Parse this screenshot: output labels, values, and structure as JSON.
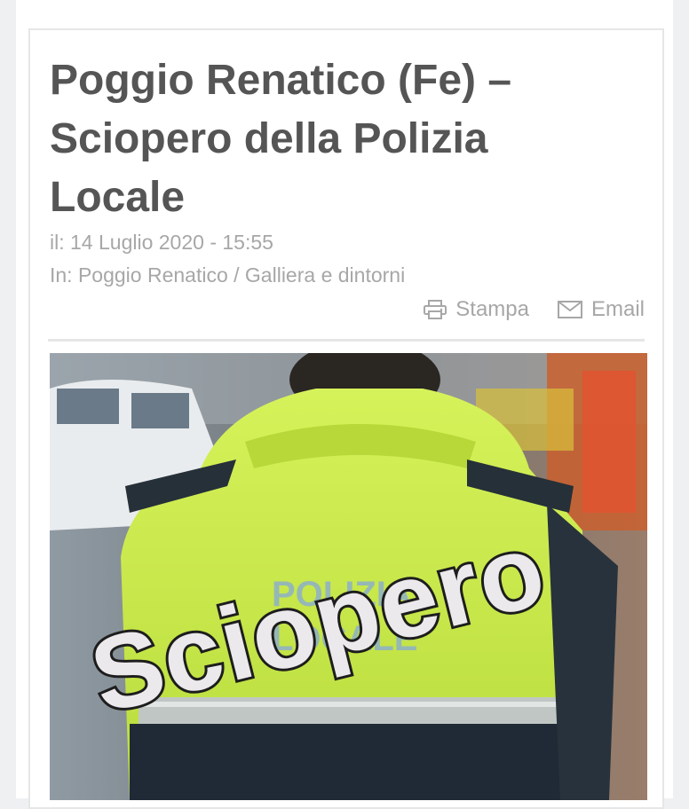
{
  "article": {
    "title": "Poggio Renatico (Fe) – Sciopero della Polizia Locale",
    "date_prefix": "il:",
    "date": "14 Luglio 2020 - 15:55",
    "category_prefix": "In:",
    "category": "Poggio Renatico / Galliera e dintorni"
  },
  "actions": {
    "print_label": "Stampa",
    "email_label": "Email",
    "print_icon": "printer-icon",
    "email_icon": "envelope-icon"
  },
  "image": {
    "overlay_text": "Sciopero",
    "jacket_text_line1": "POLIZIA",
    "jacket_text_line2": "LOCALE"
  },
  "colors": {
    "title": "#555555",
    "meta": "#a7a7a7",
    "divider": "#e6e6e6",
    "jacket": "#c7e84a"
  }
}
